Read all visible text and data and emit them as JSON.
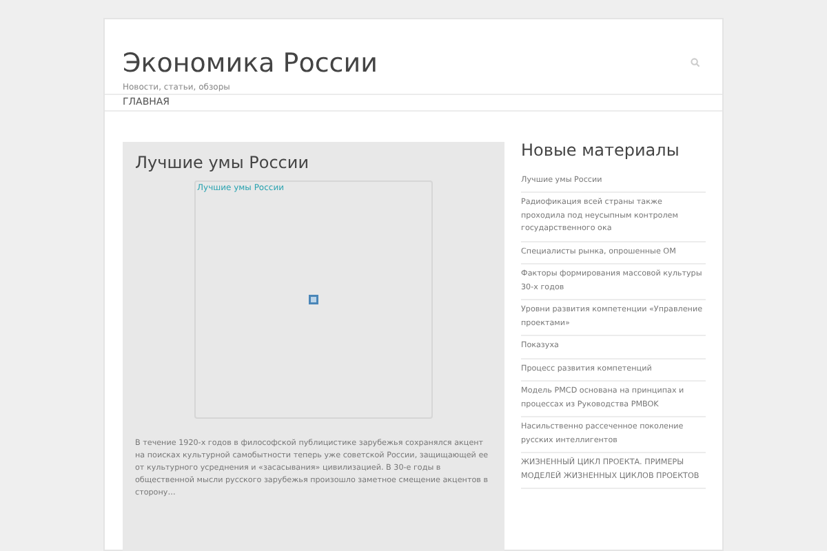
{
  "site": {
    "title": "Экономика России",
    "tagline": "Новости, статьи, обзоры"
  },
  "nav": [
    {
      "label": "ГЛАВНАЯ"
    }
  ],
  "post": {
    "title": "Лучшие умы России",
    "image_link": "Лучшие умы России",
    "excerpt": "В течение 1920-х годов в философской публицистике зарубежья сохранялся акцент на поисках культурной самобытности теперь уже советской России, защищающей ее от культурного усреднения и «засасывания» цивилизацией. В 30-е годы в общественной мысли русского зарубежья произошло заметное смещение акцентов в сторону…"
  },
  "sidebar": {
    "heading": "Новые материалы",
    "items": [
      "Лучшие умы России",
      "Радиофикация всей страны также проходила под неусыпным контролем государственного ока",
      "Специалисты рынка, опрошенные ОМ",
      "Факторы формирования массовой культуры 30-х годов",
      "Уровни развития компетенции «Управление проектами»",
      "Показуха",
      "Процесс развития компетенций",
      "Модель PMCD основана на принципах и процессах из Руководства PMBOK",
      "Насильственно рассеченное поколение русских интеллигентов",
      "ЖИЗНЕННЫЙ ЦИКЛ ПРОЕКТА. ПРИМЕРЫ МОДЕЛЕЙ ЖИЗНЕННЫХ ЦИКЛОВ ПРОЕКТОВ"
    ]
  }
}
